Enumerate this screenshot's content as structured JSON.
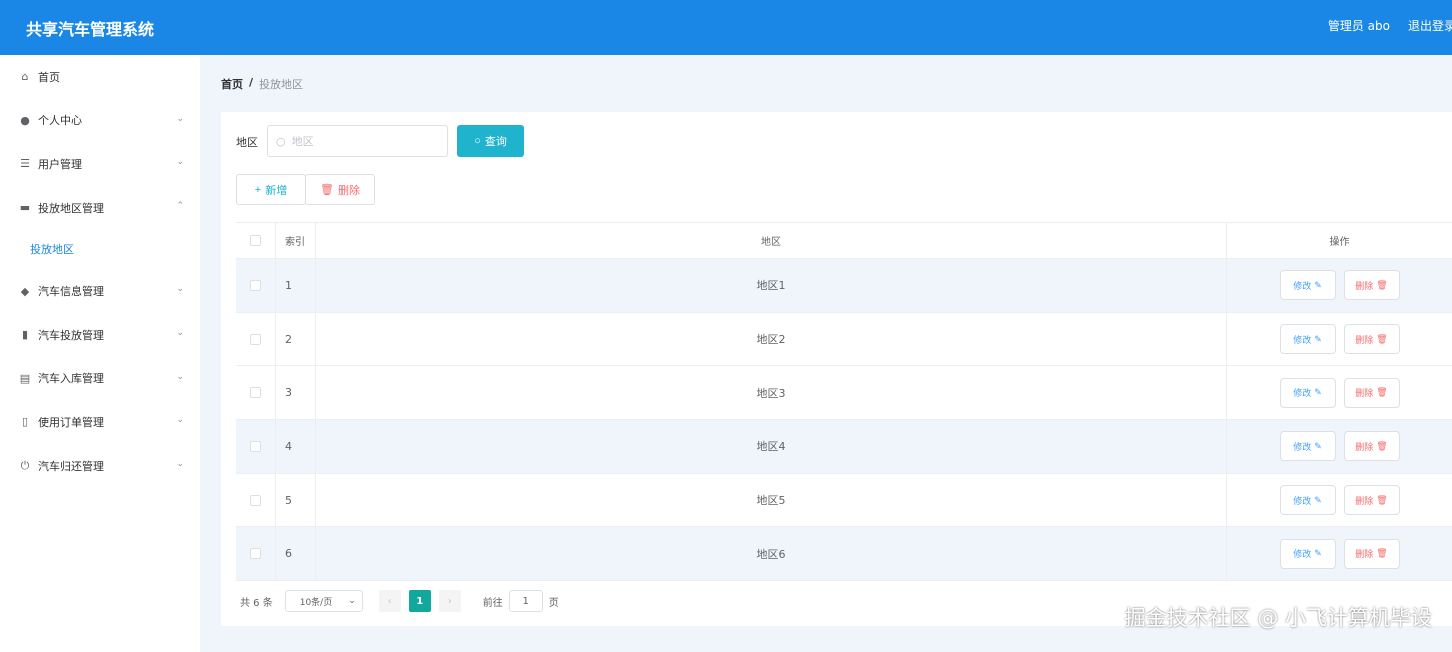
{
  "header": {
    "title": "共享汽车管理系统",
    "user": "管理员 abo",
    "logout": "退出登录"
  },
  "sidebar": {
    "items": [
      {
        "label": "首页",
        "icon": "home-icon"
      },
      {
        "label": "个人中心",
        "icon": "user-icon"
      },
      {
        "label": "用户管理",
        "icon": "list-icon"
      },
      {
        "label": "投放地区管理",
        "icon": "monitor-icon"
      },
      {
        "label": "汽车信息管理",
        "icon": "location-icon"
      },
      {
        "label": "汽车投放管理",
        "icon": "bar-chart-icon"
      },
      {
        "label": "汽车入库管理",
        "icon": "clipboard-icon"
      },
      {
        "label": "使用订单管理",
        "icon": "phone-icon"
      },
      {
        "label": "汽车归还管理",
        "icon": "power-icon"
      }
    ],
    "active_sub": "投放地区"
  },
  "breadcrumb": {
    "home": "首页",
    "separator": "/",
    "current": "投放地区"
  },
  "search": {
    "label": "地区",
    "placeholder": "地区",
    "button": "查询"
  },
  "actions": {
    "add": "新增",
    "delete": "删除"
  },
  "table": {
    "headers": {
      "index": "索引",
      "region": "地区",
      "ops": "操作"
    },
    "rows": [
      {
        "index": "1",
        "region": "地区1"
      },
      {
        "index": "2",
        "region": "地区2"
      },
      {
        "index": "3",
        "region": "地区3"
      },
      {
        "index": "4",
        "region": "地区4"
      },
      {
        "index": "5",
        "region": "地区5"
      },
      {
        "index": "6",
        "region": "地区6"
      }
    ],
    "edit_label": "修改",
    "delete_label": "删除"
  },
  "pagination": {
    "total": "共 6 条",
    "page_size": "10条/页",
    "current_page": "1",
    "goto_prefix": "前往",
    "goto_value": "1",
    "goto_suffix": "页"
  },
  "watermark": "掘金技术社区 @ 小飞计算机毕设",
  "colors": {
    "header": "#1a87e6",
    "query_button": "#1fb3cd",
    "page_active": "#13a89e",
    "danger": "#f56c6c",
    "primary": "#409eff"
  }
}
